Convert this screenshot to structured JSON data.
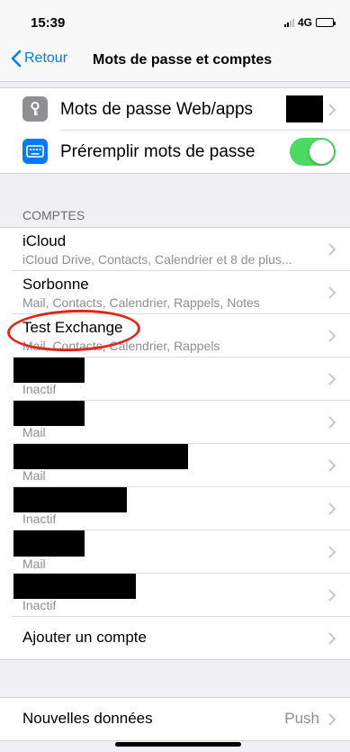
{
  "status_bar": {
    "time": "15:39",
    "network": "4G"
  },
  "nav": {
    "back_label": "Retour",
    "title": "Mots de passe et comptes"
  },
  "passwords_group": {
    "web_apps_label": "Mots de passe Web/apps",
    "autofill_label": "Préremplir mots de passe",
    "autofill_enabled": true,
    "toggle_color": "#4cd964",
    "key_icon_color": "#8e8e93",
    "keyboard_icon_color": "#007aff"
  },
  "accounts": {
    "header": "COMPTES",
    "items": [
      {
        "title": "iCloud",
        "subtitle": "iCloud Drive, Contacts, Calendrier et 8 de plus..."
      },
      {
        "title": "Sorbonne",
        "subtitle": "Mail, Contacts, Calendrier, Rappels, Notes"
      },
      {
        "title": "Test Exchange",
        "subtitle": "Mail, Contacts, Calendrier, Rappels"
      },
      {
        "title": "",
        "subtitle": "Inactif"
      },
      {
        "title": "",
        "subtitle": "Mail"
      },
      {
        "title": "",
        "subtitle": "Mail"
      },
      {
        "title": "",
        "subtitle": "Inactif"
      },
      {
        "title": "",
        "subtitle": "Mail"
      },
      {
        "title": "",
        "subtitle": "Inactif"
      }
    ],
    "add_account_label": "Ajouter un compte"
  },
  "fetch": {
    "label": "Nouvelles données",
    "value": "Push"
  },
  "colors": {
    "accent": "#007aff",
    "annotation": "#e0261b"
  }
}
